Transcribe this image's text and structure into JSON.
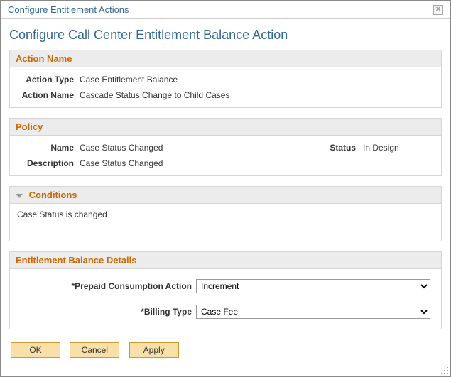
{
  "dialog": {
    "title": "Configure Entitlement Actions"
  },
  "page": {
    "title": "Configure Call Center Entitlement Balance Action"
  },
  "sections": {
    "action_name": {
      "header": "Action Name",
      "action_type_label": "Action Type",
      "action_type_value": "Case Entitlement Balance",
      "action_name_label": "Action Name",
      "action_name_value": "Cascade Status Change to Child Cases"
    },
    "policy": {
      "header": "Policy",
      "name_label": "Name",
      "name_value": "Case Status Changed",
      "status_label": "Status",
      "status_value": "In Design",
      "description_label": "Description",
      "description_value": "Case Status Changed"
    },
    "conditions": {
      "header": "Conditions",
      "text": "Case Status is changed"
    },
    "balance_details": {
      "header": "Entitlement Balance Details",
      "prepaid_label": "*Prepaid Consumption Action",
      "prepaid_value": "Increment",
      "billing_label": "*Billing Type",
      "billing_value": "Case Fee"
    }
  },
  "buttons": {
    "ok": "OK",
    "cancel": "Cancel",
    "apply": "Apply"
  }
}
